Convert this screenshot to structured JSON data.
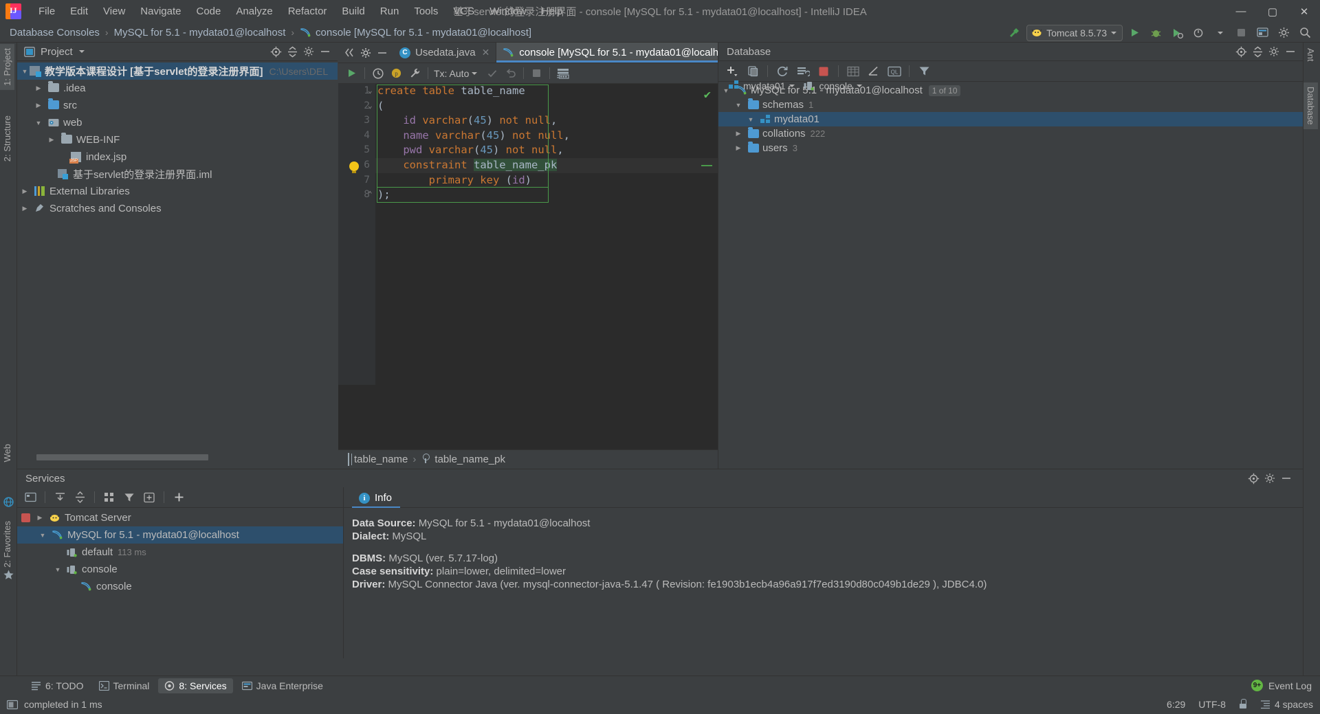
{
  "window": {
    "title": "基于servlet的登录注册界面 - console [MySQL for 5.1 - mydata01@localhost] - IntelliJ IDEA",
    "minimize": "—",
    "maximize": "▢",
    "close": "✕"
  },
  "menubar": {
    "items": [
      {
        "label": "File"
      },
      {
        "label": "Edit"
      },
      {
        "label": "View"
      },
      {
        "label": "Navigate"
      },
      {
        "label": "Code"
      },
      {
        "label": "Analyze"
      },
      {
        "label": "Refactor"
      },
      {
        "label": "Build"
      },
      {
        "label": "Run"
      },
      {
        "label": "Tools"
      },
      {
        "label": "VCS"
      },
      {
        "label": "Window"
      },
      {
        "label": "Help"
      }
    ]
  },
  "navbar": {
    "crumbs": [
      {
        "label": "Database Consoles"
      },
      {
        "label": "MySQL for 5.1 - mydata01@localhost"
      },
      {
        "label": "console [MySQL for 5.1 - mydata01@localhost]"
      }
    ],
    "separator": "›",
    "run_config": "Tomcat 8.5.73"
  },
  "project_panel": {
    "title": "Project",
    "tree": [
      {
        "label": "教学版本课程设计 [基于servlet的登录注册界面]",
        "path": "C:\\Users\\DEL",
        "indent": 0,
        "arrow": "▼",
        "icon": "module-icon",
        "selected": true
      },
      {
        "label": ".idea",
        "indent": 1,
        "arrow": "▶",
        "icon": "folder-icon"
      },
      {
        "label": "src",
        "indent": 1,
        "arrow": "▶",
        "icon": "folder-blue-icon"
      },
      {
        "label": "web",
        "indent": 1,
        "arrow": "▼",
        "icon": "web-folder-icon"
      },
      {
        "label": "WEB-INF",
        "indent": 2,
        "arrow": "▶",
        "icon": "folder-icon"
      },
      {
        "label": "index.jsp",
        "indent": 2,
        "arrow": "",
        "icon": "jsp-file-icon"
      },
      {
        "label": "基于servlet的登录注册界面.iml",
        "indent": 1,
        "arrow": "",
        "icon": "iml-file-icon"
      },
      {
        "label": "External Libraries",
        "indent": 0,
        "arrow": "▶",
        "icon": "library-icon"
      },
      {
        "label": "Scratches and Consoles",
        "indent": 0,
        "arrow": "▶",
        "icon": "scratches-icon"
      }
    ]
  },
  "editor": {
    "tabs": [
      {
        "label": "Usedata.java",
        "icon": "java-class-icon",
        "active": false,
        "close": "✕"
      },
      {
        "label": "console [MySQL for 5.1 - mydata01@localhost]",
        "icon": "mysql-console-icon",
        "active": true,
        "close": "✕"
      }
    ],
    "toolbar": {
      "run_label": "run-icon",
      "tx_label": "Tx: Auto",
      "schema_selector": "mydata01",
      "session_selector": "console"
    },
    "lines": [
      {
        "n": "1",
        "tokens": [
          {
            "t": "create table ",
            "c": "k"
          },
          {
            "t": "table_name",
            "c": "id"
          }
        ]
      },
      {
        "n": "2",
        "tokens": [
          {
            "t": "(",
            "c": "pl"
          }
        ]
      },
      {
        "n": "3",
        "tokens": [
          {
            "t": "    id ",
            "c": "fld"
          },
          {
            "t": "varchar",
            "c": "k"
          },
          {
            "t": "(",
            "c": "pl"
          },
          {
            "t": "45",
            "c": "num"
          },
          {
            "t": ") ",
            "c": "pl"
          },
          {
            "t": "not null",
            "c": "k"
          },
          {
            "t": ",",
            "c": "pl"
          }
        ]
      },
      {
        "n": "4",
        "tokens": [
          {
            "t": "    name ",
            "c": "fld"
          },
          {
            "t": "varchar",
            "c": "k"
          },
          {
            "t": "(",
            "c": "pl"
          },
          {
            "t": "45",
            "c": "num"
          },
          {
            "t": ") ",
            "c": "pl"
          },
          {
            "t": "not null",
            "c": "k"
          },
          {
            "t": ",",
            "c": "pl"
          }
        ]
      },
      {
        "n": "5",
        "tokens": [
          {
            "t": "    pwd ",
            "c": "fld"
          },
          {
            "t": "varchar",
            "c": "k"
          },
          {
            "t": "(",
            "c": "pl"
          },
          {
            "t": "45",
            "c": "num"
          },
          {
            "t": ") ",
            "c": "pl"
          },
          {
            "t": "not null",
            "c": "k"
          },
          {
            "t": ",",
            "c": "pl"
          }
        ]
      },
      {
        "n": "6",
        "tokens": [
          {
            "t": "    constraint ",
            "c": "k"
          },
          {
            "t": "table_name_pk",
            "c": "hl"
          }
        ],
        "highlight": true,
        "bulb": true
      },
      {
        "n": "7",
        "tokens": [
          {
            "t": "        primary key ",
            "c": "k"
          },
          {
            "t": "(",
            "c": "pl"
          },
          {
            "t": "id",
            "c": "fld"
          },
          {
            "t": ")",
            "c": "pl"
          }
        ]
      },
      {
        "n": "8",
        "tokens": [
          {
            "t": ");",
            "c": "pl"
          }
        ]
      }
    ],
    "breadcrumb": [
      {
        "label": "table_name",
        "icon": "table-icon"
      },
      {
        "label": "table_name_pk",
        "icon": "key-icon"
      }
    ],
    "breadcrumb_sep": "›"
  },
  "database_panel": {
    "title": "Database",
    "tree": [
      {
        "label": "MySQL for 5.1 - mydata01@localhost",
        "indent": 0,
        "arrow": "▼",
        "icon": "mysql-icon",
        "badge": "1 of 10"
      },
      {
        "label": "schemas",
        "indent": 1,
        "arrow": "▼",
        "icon": "folder-blue-icon",
        "count": "1"
      },
      {
        "label": "mydata01",
        "indent": 2,
        "arrow": "▼",
        "icon": "schema-icon",
        "selected": true
      },
      {
        "label": "collations",
        "indent": 2,
        "arrow": "▶",
        "icon": "folder-blue-icon",
        "count": "222"
      },
      {
        "label": "users",
        "indent": 2,
        "arrow": "▶",
        "icon": "folder-blue-icon",
        "count": "3"
      }
    ]
  },
  "services_panel": {
    "title": "Services",
    "tree": [
      {
        "label": "Tomcat Server",
        "indent": 0,
        "arrow": "▶",
        "icon": "tomcat-icon",
        "stop": true
      },
      {
        "label": "MySQL for 5.1 - mydata01@localhost",
        "indent": 1,
        "arrow": "▼",
        "icon": "mysql-icon",
        "selected": true
      },
      {
        "label": "default",
        "indent": 2,
        "arrow": "",
        "icon": "session-icon",
        "meta": "113 ms"
      },
      {
        "label": "console",
        "indent": 2,
        "arrow": "▼",
        "icon": "session-icon"
      },
      {
        "label": "console",
        "indent": 3,
        "arrow": "",
        "icon": "mysql-icon"
      }
    ],
    "info_tab": "Info",
    "info": [
      {
        "key": "Data Source:",
        "value": " MySQL for 5.1 - mydata01@localhost"
      },
      {
        "key": "Dialect:",
        "value": " MySQL"
      },
      {
        "key": "",
        "value": ""
      },
      {
        "key": "DBMS:",
        "value": " MySQL (ver. 5.7.17-log)"
      },
      {
        "key": "Case sensitivity:",
        "value": " plain=lower, delimited=lower"
      },
      {
        "key": "Driver:",
        "value": " MySQL Connector Java (ver. mysql-connector-java-5.1.47 ( Revision: fe1903b1ecb4a96a917f7ed3190d80c049b1de29 ), JDBC4.0)"
      }
    ]
  },
  "bottom_bar": {
    "tabs": [
      {
        "label": "6: TODO",
        "icon": "todo-icon",
        "active": false
      },
      {
        "label": "Terminal",
        "icon": "terminal-icon",
        "active": false
      },
      {
        "label": "8: Services",
        "icon": "services-icon",
        "active": true
      },
      {
        "label": "Java Enterprise",
        "icon": "java-enterprise-icon",
        "active": false
      }
    ],
    "event_log": "Event Log",
    "event_count": "9+"
  },
  "status_bar": {
    "message": "completed in 1 ms",
    "caret": "6:29",
    "encoding": "UTF-8",
    "indent": "4 spaces"
  },
  "left_stripe": {
    "tabs": [
      {
        "label": "1: Project",
        "active": true
      },
      {
        "label": "2: Structure",
        "active": false
      },
      {
        "label": "Web",
        "active": false
      },
      {
        "label": "2: Favorites",
        "active": false
      }
    ]
  },
  "right_stripe": {
    "tabs": [
      {
        "label": "Ant",
        "active": false
      },
      {
        "label": "Database",
        "active": true
      }
    ]
  },
  "colors": {
    "accent": "#4a88c7",
    "selection": "#2d4f6c",
    "panel": "#3c3f41",
    "editor": "#2b2b2b",
    "keyword": "#cc7832",
    "number": "#6897bb",
    "field": "#9876aa",
    "plain": "#a9b7c6",
    "success": "#62b543",
    "stop": "#c75450"
  }
}
